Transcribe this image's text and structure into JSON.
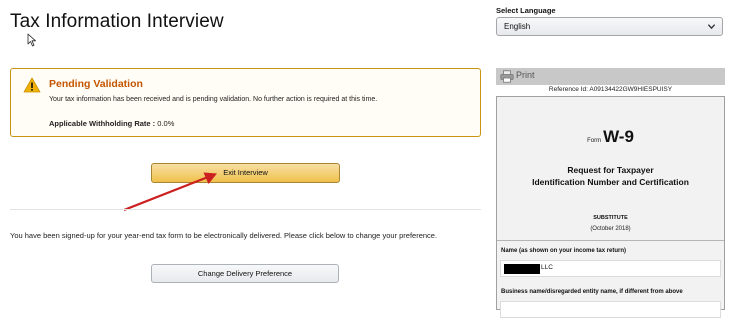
{
  "page": {
    "title": "Tax Information Interview"
  },
  "language": {
    "label": "Select Language",
    "selected": "English"
  },
  "alert": {
    "title": "Pending Validation",
    "message": "Your tax information has been received and is pending validation. No further action is required at this time.",
    "rate_label": "Applicable Withholding Rate :",
    "rate_value": "0.0%",
    "accent_color": "#c45500",
    "border_color": "#c89411"
  },
  "actions": {
    "exit_label": "Exit Interview",
    "delivery_text": "You have been signed-up for your year-end tax form to be electronically delivered. Please click below to change your preference.",
    "change_delivery_label": "Change Delivery Preference"
  },
  "annotation": {
    "arrow_color": "#cc1f1f"
  },
  "form_preview": {
    "print_label": "Print",
    "reference_id": "Reference Id: A09134422GW9HIESPUISY",
    "form_word": "Form",
    "form_name": "W-9",
    "title_line1": "Request for Taxpayer",
    "title_line2": "Identification Number and Certification",
    "substitute": "SUBSTITUTE",
    "revision": "(October 2018)",
    "name_label": "Name (as shown on your income tax return)",
    "name_value": "LLC",
    "business_label": "Business name/disregarded entity name, if different from above",
    "business_value": ""
  },
  "icons": {
    "warning": "warning-icon",
    "print": "printer-icon",
    "chevron": "chevron-down-icon",
    "cursor": "mouse-cursor-icon"
  }
}
